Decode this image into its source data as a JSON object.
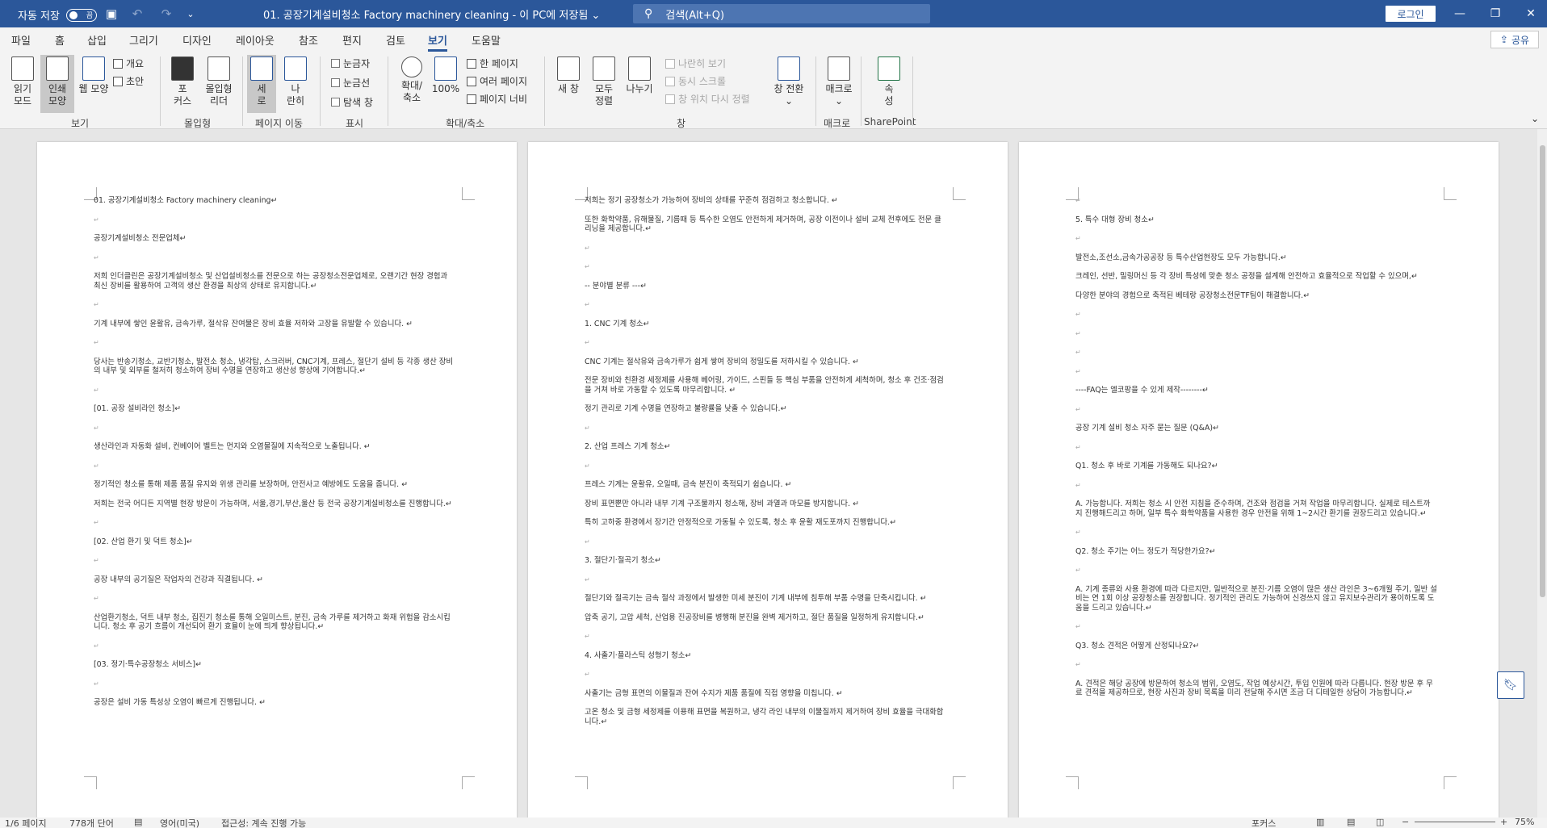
{
  "titlebar": {
    "autosave_label": "자동 저장",
    "autosave_state": "끔",
    "doc_title": "01. 공장기계설비청소 Factory machinery cleaning  -  이 PC에 저장됨  ⌄",
    "search_placeholder": "검색(Alt+Q)",
    "login_label": "로그인"
  },
  "menu": {
    "tabs": [
      "파일",
      "홈",
      "삽입",
      "그리기",
      "디자인",
      "레이아웃",
      "참조",
      "편지",
      "검토",
      "보기",
      "도움말"
    ],
    "active": "보기",
    "share_label": "공유"
  },
  "ribbon": {
    "read_mode": [
      "읽기",
      "모드"
    ],
    "print_layout": [
      "인쇄",
      "모양"
    ],
    "web_layout": "웹 모양",
    "outline": "개요",
    "draft": "초안",
    "group_view": "보기",
    "focus": [
      "포",
      "커스"
    ],
    "immersive_reader": [
      "몰입형",
      "리더"
    ],
    "group_immersive": "몰입형",
    "vertical": [
      "세",
      "로"
    ],
    "side_by_side": [
      "나",
      "란히"
    ],
    "group_page_move": "페이지 이동",
    "ruler": "눈금자",
    "gridlines": "눈금선",
    "nav_pane": "탐색 창",
    "group_show": "표시",
    "zoom": [
      "확대/",
      "축소"
    ],
    "zoom100": "100%",
    "one_page": "한 페이지",
    "multi_page": "여러 페이지",
    "page_width": "페이지 너비",
    "group_zoom": "확대/축소",
    "new_window": "새 창",
    "arrange_all": [
      "모두",
      "정렬"
    ],
    "split": "나누기",
    "view_side": "나란히 보기",
    "sync_scroll": "동시 스크롤",
    "reset_window": "창 위치 다시 정렬",
    "switch_window": [
      "창 전환",
      "⌄"
    ],
    "group_window": "창",
    "macros": [
      "매크로",
      "⌄"
    ],
    "group_macro": "매크로",
    "properties": [
      "속",
      "성"
    ],
    "group_sharepoint": "SharePoint"
  },
  "pages": [
    {
      "paragraphs": [
        "01. 공장기계설비청소 Factory machinery cleaning↵",
        "",
        "공장기계설비청소 전문업체↵",
        "",
        "저희 인더클린은 공장기계설비청소 및 산업설비청소를 전문으로 하는 공장청소전문업체로, 오랜기간 현장 경험과 최신 장비를 활용하여 고객의 생산 환경을 최상의 상태로 유지합니다.↵",
        "",
        "기계 내부에 쌓인 윤활유, 금속가루, 절삭유 잔여물은 장비 효율 저하와 고장을 유발할 수 있습니다. ↵",
        "",
        "당사는 반송기청소, 교반기청소, 발전소 청소, 냉각탑, 스크러버, CNC기계, 프레스, 절단기 설비 등 각종 생산 장비의 내부 및 외부를 철저히 청소하여 장비 수명을 연장하고 생산성 향상에 기여합니다.↵",
        "",
        "[01. 공장 설비라인 청소]↵",
        "",
        "생산라인과 자동화 설비, 컨베이어 벨트는 먼지와 오염물질에 지속적으로 노출됩니다. ↵",
        "",
        "정기적인 청소를 통해 제품 품질 유지와 위생 관리를 보장하며, 안전사고 예방에도 도움을 줍니다. ↵",
        "저희는 전국 어디든 지역별 현장 방문이 가능하며, 서울,경기,부산,울산 등 전국 공장기계설비청소를 진행합니다.↵",
        "",
        "[02. 산업 환기 및 덕트 청소]↵",
        "",
        "공장 내부의 공기질은 작업자의 건강과 직결됩니다. ↵",
        "",
        "산업환기청소, 덕트 내부 청소, 집진기 청소를 통해 오일미스트, 분진, 금속 가루를 제거하고 화재 위험을 감소시킵니다. 청소 후 공기 흐름이 개선되어 환기 효율이 눈에 띄게 향상됩니다.↵",
        "",
        "[03. 정기·특수공장청소 서비스]↵",
        "",
        "공장은 설비 가동 특성상 오염이 빠르게 진행됩니다. ↵"
      ]
    },
    {
      "paragraphs": [
        "저희는 정기 공장청소가 가능하여 장비의 상태를 꾸준히 점검하고 청소합니다. ↵",
        "또한 화학약품, 유해물질, 기름때 등 특수한 오염도 안전하게 제거하며, 공장 이전이나 설비 교체 전후에도 전문 클리닝을 제공합니다.↵",
        "",
        "",
        "-- 분야별 분류 ---↵",
        "",
        "1. CNC 기계 청소↵",
        "",
        "CNC 기계는 절삭유와 금속가루가 쉽게 쌓여 장비의 정밀도를 저하시킬 수 있습니다. ↵",
        "전문 장비와 친환경 세정제를 사용해 베어링, 가이드, 스핀들 등 핵심 부품을 안전하게 세척하며, 청소 후 건조·점검을 거쳐 바로 가동할 수 있도록 마무리합니다. ↵",
        "정기 관리로 기계 수명을 연장하고 불량률을 낮출 수 있습니다.↵",
        "",
        "2. 산업 프레스 기계 청소↵",
        "",
        "프레스 기계는 윤활유, 오일때, 금속 분진이 축적되기 쉽습니다. ↵",
        "장비 표면뿐만 아니라 내부 기계 구조물까지 청소해, 장비 과열과 마모를 방지합니다. ↵",
        "특히 고하중 환경에서 장기간 안정적으로 가동될 수 있도록, 청소 후 윤활 재도포까지 진행합니다.↵",
        "",
        "3. 절단기·절곡기 청소↵",
        "",
        "절단기와 절곡기는 금속 절삭 과정에서 발생한 미세 분진이 기계 내부에 침투해 부품 수명을 단축시킵니다. ↵",
        "압축 공기, 고압 세척, 산업용 진공장비를 병행해 분진을 완벽 제거하고, 절단 품질을 일정하게 유지합니다.↵",
        "",
        "4. 사출기·플라스틱 성형기 청소↵",
        "",
        "사출기는 금형 표면의 이물질과 잔여 수지가 제품 품질에 직접 영향을 미칩니다. ↵",
        "고온 청소 및 금형 세정제를 이용해 표면을 복원하고, 냉각 라인 내부의 이물질까지 제거하여 장비 효율을 극대화합니다.↵"
      ]
    },
    {
      "paragraphs": [
        "",
        "5. 특수 대형 장비 청소↵",
        "",
        "발전소,조선소,금속가공공장 등 특수산업현장도 모두 가능합니다.↵",
        "크레인, 선반, 밀링머신 등 각 장비 특성에 맞춘 청소 공정을 설계해 안전하고 효율적으로 작업할 수 있으며,↵",
        "다양한 분야의 경험으로 축적된 베테랑 공장청소전문TF팀이 해결합니다.↵",
        "",
        "",
        "",
        "",
        "----FAQ는 엘코팡을 수 있게 제작--------↵",
        "",
        "공장 기계 설비 청소 자주 묻는 질문 (Q&A)↵",
        "",
        "Q1. 청소 후 바로 기계를 가동해도 되나요?↵",
        "",
        "A. 가능합니다. 저희는 청소 시 안전 지침을 준수하며, 건조와 점검을 거쳐 작업을 마무리합니다. 실제로 테스트까지 진행해드리고 하며, 일부 특수 화학약품을 사용한 경우 안전을 위해 1~2시간 환기를 권장드리고 있습니다.↵",
        "",
        "Q2. 청소 주기는 어느 정도가 적당한가요?↵",
        "",
        "A. 기계 종류와 사용 환경에 따라 다르지만, 일반적으로 분진·기름 오염이 많은 생산 라인은 3~6개월 주기, 일반 설비는 연 1회 이상 공장청소를 권장합니다. 정기적인 관리도 가능하여 신경쓰지 않고 유지보수관리가 용이하도록 도움을 드리고 있습니다.↵",
        "",
        "Q3. 청소 견적은 어떻게 산정되나요?↵",
        "",
        "A. 견적은 해당 공장에 방문하여 청소의 범위, 오염도, 작업 예상시간, 투입 인원에 따라 다릅니다. 현장 방문 후 무료 견적을 제공하므로, 현장 사진과 장비 목록을 미리 전달해 주시면 조금 더 디테일한 상담이 가능합니다.↵"
      ]
    }
  ],
  "statusbar": {
    "page": "1/6 페이지",
    "words": "778개 단어",
    "language": "영어(미국)",
    "accessibility": "접근성: 계속 진행 가능",
    "focus": "포커스",
    "zoom": "75%"
  },
  "colors": {
    "accent": "#2b579a"
  }
}
